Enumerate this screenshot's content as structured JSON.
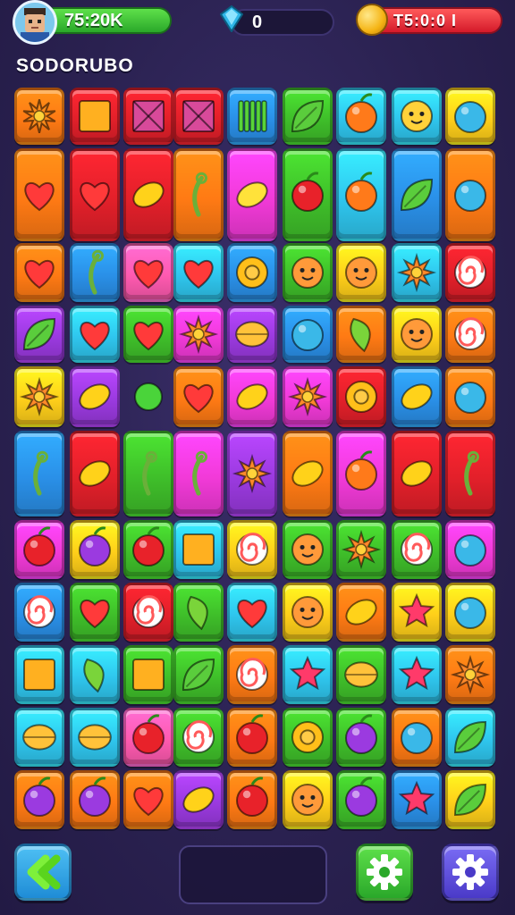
{
  "header": {
    "score": "75:20K",
    "gems": "0",
    "coins": "T5:0:0 I",
    "title": "SODORUBO"
  },
  "colors": {
    "background": "#2b2350",
    "score_pill": "#3cc23a",
    "coin_pill": "#e82a36"
  },
  "bottom": {
    "back_button": "chevron-left-icon",
    "settings_green": "gear-icon",
    "settings_purple": "gear-icon"
  },
  "tile_palette": {
    "y": "#ffcf1a",
    "o": "#ff7a14",
    "r": "#e3202a",
    "g": "#3fbf2a",
    "c": "#2fc6ee",
    "b": "#2a90e8",
    "p": "#f23ad8",
    "v": "#9b3ae0",
    "m": "#ff5ab0"
  },
  "board": [
    [
      "o:sun",
      "r:box",
      "r:crate",
      "r:crate",
      "b:grass",
      "g:leaf",
      "c:orange",
      "c:smiley",
      "y:ball"
    ],
    [
      "o:heart",
      "r:heart",
      "r:lemon",
      "o:sprig",
      "p:banana",
      "g:apple",
      "c:orange",
      "b:leaf",
      "o:ball"
    ],
    [
      "o:heart",
      "b:sprig",
      "m:heart",
      "c:heart",
      "b:ring",
      "g:face",
      "y:face",
      "c:flower",
      "r:swirl"
    ],
    [
      "v:leaf",
      "c:heart",
      "g:heart",
      "p:flower",
      "v:bun",
      "b:ball",
      "o:pepper",
      "y:face",
      "o:swirl"
    ],
    [
      "y:flower",
      "v:lemon",
      "x:ball",
      "o:heart",
      "p:lemon",
      "p:flower",
      "r:ring",
      "b:lemon",
      "o:ball"
    ],
    [
      "b:sprig",
      "r:lemon",
      "g:sprig",
      "p:sprig",
      "v:flower",
      "o:lemon",
      "p:orange",
      "r:lemon",
      "r:sprig"
    ],
    [
      "p:apple",
      "y:berry",
      "g:apple",
      "c:box",
      "y:swirl",
      "g:face",
      "g:flower",
      "g:swirl",
      "p:ball"
    ],
    [
      "b:swirl",
      "g:heart",
      "r:swirl",
      "g:pepper",
      "c:heart",
      "y:face",
      "o:lemon",
      "y:star",
      "y:ball"
    ],
    [
      "c:box",
      "c:pepper",
      "g:box",
      "g:leaf",
      "o:swirl",
      "c:star",
      "g:bun",
      "c:star",
      "o:flower"
    ],
    [
      "c:bun",
      "c:bun",
      "m:apple",
      "g:swirl",
      "o:apple",
      "g:ring",
      "g:berry",
      "o:ball",
      "c:leaf"
    ],
    [
      "o:berry",
      "o:berry",
      "o:heart",
      "v:lemon",
      "o:apple",
      "y:face",
      "g:berry",
      "b:star",
      "y:leaf"
    ]
  ]
}
